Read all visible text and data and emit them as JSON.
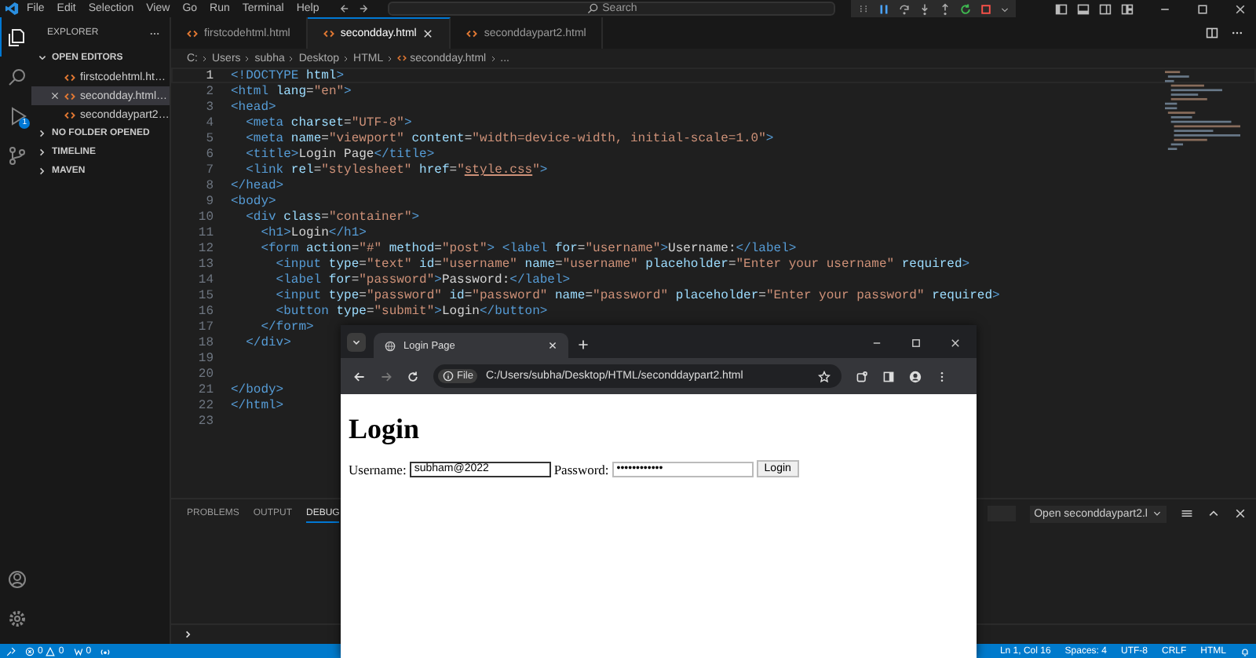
{
  "titlebar": {
    "menu": [
      "File",
      "Edit",
      "Selection",
      "View",
      "Go",
      "Run",
      "Terminal",
      "Help"
    ],
    "search": {
      "placeholder": "Search"
    }
  },
  "activity_bar": {
    "items": [
      {
        "kind": "files",
        "selected": true
      },
      {
        "kind": "search",
        "selected": false
      },
      {
        "kind": "debug",
        "selected": false,
        "badge": "1"
      },
      {
        "kind": "source-control",
        "selected": false
      }
    ],
    "bottom": [
      {
        "kind": "account"
      },
      {
        "kind": "settings"
      }
    ]
  },
  "sidebar": {
    "title": "EXPLORER",
    "sections": [
      {
        "label": "OPEN EDITORS",
        "expanded": true,
        "items": [
          {
            "name": "firstcodehtml.ht…",
            "selected": false
          },
          {
            "name": "secondday.html…",
            "selected": true
          },
          {
            "name": "seconddaypart2…",
            "selected": false
          }
        ]
      },
      {
        "label": "NO FOLDER OPENED",
        "expanded": false
      },
      {
        "label": "TIMELINE",
        "expanded": false
      },
      {
        "label": "MAVEN",
        "expanded": false
      }
    ]
  },
  "editor_tabs": [
    {
      "name": "firstcodehtml.html",
      "selected": false
    },
    {
      "name": "secondday.html",
      "selected": true
    },
    {
      "name": "seconddaypart2.html",
      "selected": false
    }
  ],
  "breadcrumb": [
    {
      "text": "C:",
      "kind": "folder"
    },
    {
      "text": "Users",
      "kind": "folder"
    },
    {
      "text": "subha",
      "kind": "folder"
    },
    {
      "text": "Desktop",
      "kind": "folder"
    },
    {
      "text": "HTML",
      "kind": "folder"
    },
    {
      "text": "secondday.html",
      "kind": "file"
    },
    {
      "text": "...",
      "kind": "more"
    }
  ],
  "code": {
    "lines": [
      {
        "number": "1",
        "current": true,
        "tokens": [
          {
            "kind": "tag",
            "text": "<!DOCTYPE"
          },
          {
            "kind": "attr",
            "text": " html"
          },
          {
            "kind": "tag",
            "text": ">"
          }
        ]
      },
      {
        "number": "2",
        "current": false,
        "tokens": [
          {
            "kind": "tag",
            "text": "<html"
          },
          {
            "kind": "attr",
            "text": " lang"
          },
          {
            "kind": "txt",
            "text": "="
          },
          {
            "kind": "str",
            "text": "\"en\""
          },
          {
            "kind": "tag",
            "text": ">"
          }
        ]
      },
      {
        "number": "3",
        "current": false,
        "tokens": [
          {
            "kind": "tag",
            "text": "<head>"
          }
        ]
      },
      {
        "number": "4",
        "current": false,
        "tokens": [
          {
            "kind": "tag",
            "text": "  <meta"
          },
          {
            "kind": "attr",
            "text": " charset"
          },
          {
            "kind": "txt",
            "text": "="
          },
          {
            "kind": "str",
            "text": "\"UTF-8\""
          },
          {
            "kind": "tag",
            "text": ">"
          }
        ]
      },
      {
        "number": "5",
        "current": false,
        "tokens": [
          {
            "kind": "tag",
            "text": "  <meta"
          },
          {
            "kind": "attr",
            "text": " name"
          },
          {
            "kind": "txt",
            "text": "="
          },
          {
            "kind": "str",
            "text": "\"viewport\""
          },
          {
            "kind": "attr",
            "text": " content"
          },
          {
            "kind": "txt",
            "text": "="
          },
          {
            "kind": "str",
            "text": "\"width=device-width, initial-scale=1.0\""
          },
          {
            "kind": "tag",
            "text": ">"
          }
        ]
      },
      {
        "number": "6",
        "current": false,
        "tokens": [
          {
            "kind": "tag",
            "text": "  <title>"
          },
          {
            "kind": "txt",
            "text": "Login Page"
          },
          {
            "kind": "tag",
            "text": "</title>"
          }
        ]
      },
      {
        "number": "7",
        "current": false,
        "tokens": [
          {
            "kind": "tag",
            "text": "  <link"
          },
          {
            "kind": "attr",
            "text": " rel"
          },
          {
            "kind": "txt",
            "text": "="
          },
          {
            "kind": "str",
            "text": "\"stylesheet\""
          },
          {
            "kind": "attr",
            "text": " href"
          },
          {
            "kind": "txt",
            "text": "="
          },
          {
            "kind": "str",
            "text": "\""
          },
          {
            "kind": "link",
            "text": "style.css"
          },
          {
            "kind": "str",
            "text": "\""
          },
          {
            "kind": "tag",
            "text": ">"
          }
        ]
      },
      {
        "number": "8",
        "current": false,
        "tokens": [
          {
            "kind": "tag",
            "text": "</head>"
          }
        ]
      },
      {
        "number": "9",
        "current": false,
        "tokens": [
          {
            "kind": "tag",
            "text": "<body>"
          }
        ]
      },
      {
        "number": "10",
        "current": false,
        "tokens": [
          {
            "kind": "tag",
            "text": "  <div"
          },
          {
            "kind": "attr",
            "text": " class"
          },
          {
            "kind": "txt",
            "text": "="
          },
          {
            "kind": "str",
            "text": "\"container\""
          },
          {
            "kind": "tag",
            "text": ">"
          }
        ]
      },
      {
        "number": "11",
        "current": false,
        "tokens": [
          {
            "kind": "tag",
            "text": "    <h1>"
          },
          {
            "kind": "txt",
            "text": "Login"
          },
          {
            "kind": "tag",
            "text": "</h1>"
          }
        ]
      },
      {
        "number": "12",
        "current": false,
        "tokens": [
          {
            "kind": "tag",
            "text": "    <form"
          },
          {
            "kind": "attr",
            "text": " action"
          },
          {
            "kind": "txt",
            "text": "="
          },
          {
            "kind": "str",
            "text": "\"#\""
          },
          {
            "kind": "attr",
            "text": " method"
          },
          {
            "kind": "txt",
            "text": "="
          },
          {
            "kind": "str",
            "text": "\"post\""
          },
          {
            "kind": "tag",
            "text": ">"
          },
          {
            "kind": "tag",
            "text": " <label"
          },
          {
            "kind": "attr",
            "text": " for"
          },
          {
            "kind": "txt",
            "text": "="
          },
          {
            "kind": "str",
            "text": "\"username\""
          },
          {
            "kind": "tag",
            "text": ">"
          },
          {
            "kind": "txt",
            "text": "Username:"
          },
          {
            "kind": "tag",
            "text": "</label>"
          }
        ]
      },
      {
        "number": "13",
        "current": false,
        "tokens": [
          {
            "kind": "tag",
            "text": "      <input"
          },
          {
            "kind": "attr",
            "text": " type"
          },
          {
            "kind": "txt",
            "text": "="
          },
          {
            "kind": "str",
            "text": "\"text\""
          },
          {
            "kind": "attr",
            "text": " id"
          },
          {
            "kind": "txt",
            "text": "="
          },
          {
            "kind": "str",
            "text": "\"username\""
          },
          {
            "kind": "attr",
            "text": " name"
          },
          {
            "kind": "txt",
            "text": "="
          },
          {
            "kind": "str",
            "text": "\"username\""
          },
          {
            "kind": "attr",
            "text": " placeholder"
          },
          {
            "kind": "txt",
            "text": "="
          },
          {
            "kind": "str",
            "text": "\"Enter your username\""
          },
          {
            "kind": "attr",
            "text": " required"
          },
          {
            "kind": "tag",
            "text": ">"
          }
        ]
      },
      {
        "number": "14",
        "current": false,
        "tokens": [
          {
            "kind": "tag",
            "text": "      <label"
          },
          {
            "kind": "attr",
            "text": " for"
          },
          {
            "kind": "txt",
            "text": "="
          },
          {
            "kind": "str",
            "text": "\"password\""
          },
          {
            "kind": "tag",
            "text": ">"
          },
          {
            "kind": "txt",
            "text": "Password:"
          },
          {
            "kind": "tag",
            "text": "</label>"
          }
        ]
      },
      {
        "number": "15",
        "current": false,
        "tokens": [
          {
            "kind": "tag",
            "text": "      <input"
          },
          {
            "kind": "attr",
            "text": " type"
          },
          {
            "kind": "txt",
            "text": "="
          },
          {
            "kind": "str",
            "text": "\"password\""
          },
          {
            "kind": "attr",
            "text": " id"
          },
          {
            "kind": "txt",
            "text": "="
          },
          {
            "kind": "str",
            "text": "\"password\""
          },
          {
            "kind": "attr",
            "text": " name"
          },
          {
            "kind": "txt",
            "text": "="
          },
          {
            "kind": "str",
            "text": "\"password\""
          },
          {
            "kind": "attr",
            "text": " placeholder"
          },
          {
            "kind": "txt",
            "text": "="
          },
          {
            "kind": "str",
            "text": "\"Enter your password\""
          },
          {
            "kind": "attr",
            "text": " required"
          },
          {
            "kind": "tag",
            "text": ">"
          }
        ]
      },
      {
        "number": "16",
        "current": false,
        "tokens": [
          {
            "kind": "tag",
            "text": "      <button"
          },
          {
            "kind": "attr",
            "text": " type"
          },
          {
            "kind": "txt",
            "text": "="
          },
          {
            "kind": "str",
            "text": "\"submit\""
          },
          {
            "kind": "tag",
            "text": ">"
          },
          {
            "kind": "txt",
            "text": "Login"
          },
          {
            "kind": "tag",
            "text": "</button>"
          }
        ]
      },
      {
        "number": "17",
        "current": false,
        "tokens": [
          {
            "kind": "tag",
            "text": "    </form>"
          }
        ]
      },
      {
        "number": "18",
        "current": false,
        "tokens": [
          {
            "kind": "tag",
            "text": "  </div>"
          }
        ]
      },
      {
        "number": "19",
        "current": false
      },
      {
        "number": "20",
        "current": false
      },
      {
        "number": "21",
        "current": false,
        "tokens": [
          {
            "kind": "tag",
            "text": "</body>"
          }
        ]
      },
      {
        "number": "22",
        "current": false,
        "tokens": [
          {
            "kind": "tag",
            "text": "</html>"
          }
        ]
      },
      {
        "number": "23",
        "current": false
      }
    ]
  },
  "panel": {
    "tabs": [
      {
        "label": "PROBLEMS",
        "selected": false
      },
      {
        "label": "OUTPUT",
        "selected": false
      },
      {
        "label": "DEBUG",
        "selected": true
      }
    ],
    "dropdown": "Open seconddaypart2.l"
  },
  "status_bar": {
    "errors": "0",
    "warnings": "0",
    "ports": "0",
    "right": [
      "Ln 1, Col 16",
      "Spaces: 4",
      "UTF-8",
      "CRLF",
      "HTML"
    ]
  },
  "browser": {
    "tab": {
      "title": "Login Page"
    },
    "nav": {
      "back_disabled": false,
      "forward_disabled": true
    },
    "address": {
      "chip": "File",
      "url": "C:/Users/subha/Desktop/HTML/seconddaypart2.html"
    },
    "page": {
      "heading": "Login",
      "username_label": "Username:",
      "username_value": "subham@2022",
      "password_label": "Password:",
      "password_value": "••••••••••••",
      "button": "Login"
    }
  }
}
